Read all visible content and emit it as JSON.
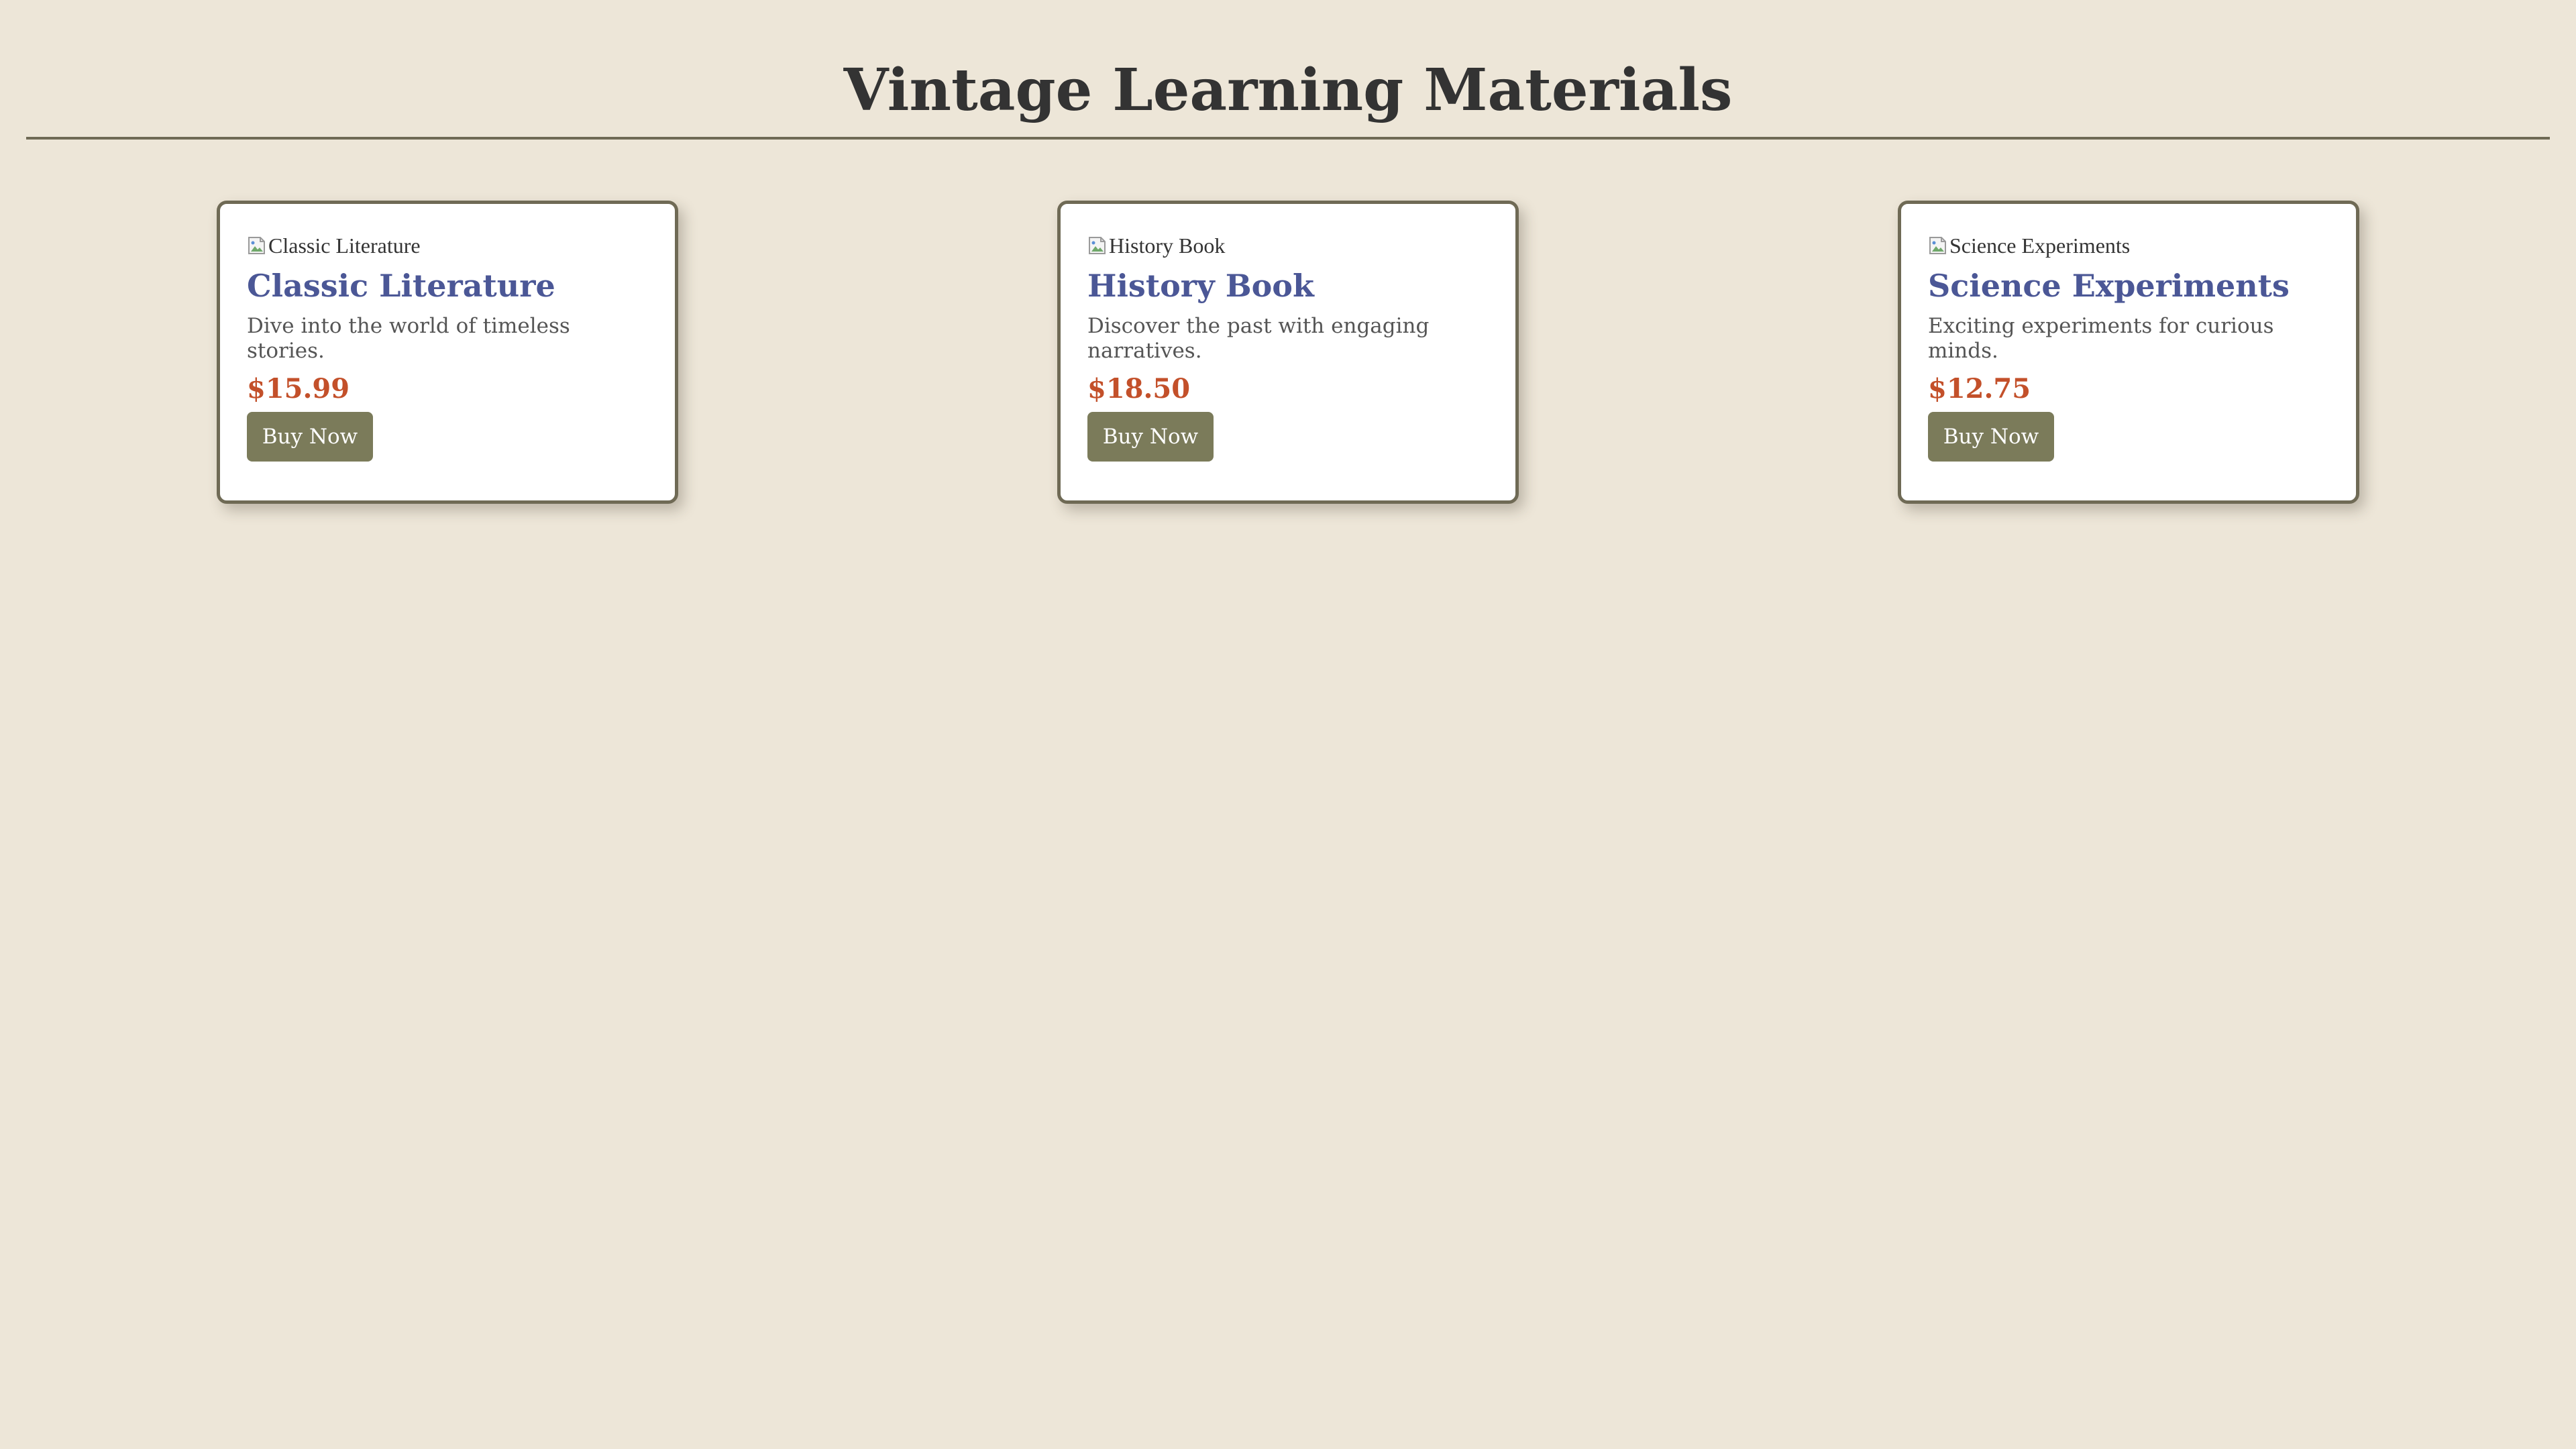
{
  "header": {
    "title": "Vintage Learning Materials"
  },
  "products": [
    {
      "image_alt": "Classic Literature",
      "title": "Classic Literature",
      "description": "Dive into the world of timeless stories.",
      "price": "$15.99",
      "button_label": "Buy Now"
    },
    {
      "image_alt": "History Book",
      "title": "History Book",
      "description": "Discover the past with engaging narratives.",
      "price": "$18.50",
      "button_label": "Buy Now"
    },
    {
      "image_alt": "Science Experiments",
      "title": "Science Experiments",
      "description": "Exciting experiments for curious minds.",
      "price": "$12.75",
      "button_label": "Buy Now"
    }
  ],
  "colors": {
    "background": "#ede6d8",
    "card_border": "#6f6a55",
    "title_accent": "#4b5796",
    "price": "#c3502a",
    "button": "#7b7b5a"
  },
  "icons": {
    "image_placeholder": "broken-image-icon"
  }
}
